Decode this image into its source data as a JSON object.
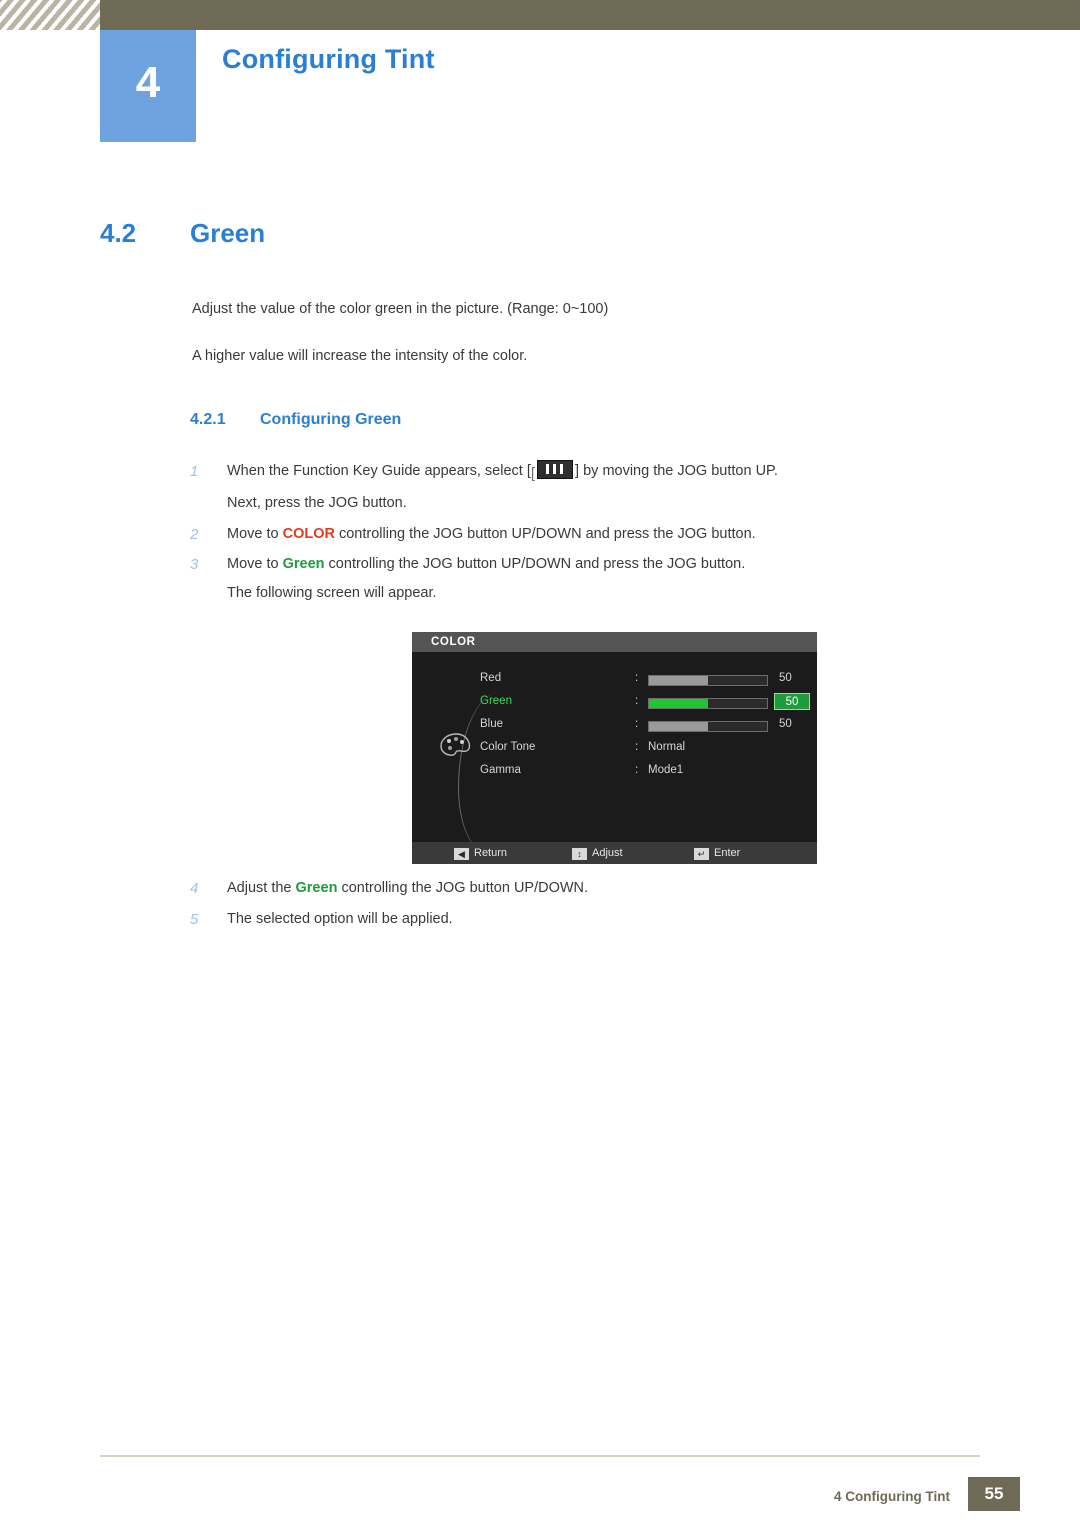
{
  "header": {
    "chapter_number": "4",
    "chapter_title": "Configuring Tint"
  },
  "section": {
    "number": "4.2",
    "title": "Green"
  },
  "intro": {
    "line1": "Adjust the value of the color green in the picture. (Range: 0~100)",
    "line2": "A higher value will increase the intensity of the color."
  },
  "subsection": {
    "number": "4.2.1",
    "title": "Configuring Green"
  },
  "steps": [
    {
      "num": "1",
      "text_before": "When the Function Key Guide appears, select [",
      "icon": "jog-guide-icon",
      "text_after": "] by moving the JOG button UP.",
      "line2": "Next, press the JOG button."
    },
    {
      "num": "2",
      "text_before": "Move to ",
      "keyword": "COLOR",
      "text_after": " controlling the JOG button UP/DOWN and press the JOG button."
    },
    {
      "num": "3",
      "text_before": "Move to ",
      "keyword": "Green",
      "text_after": " controlling the JOG button UP/DOWN and press the JOG button.",
      "line2": "The following screen will appear."
    },
    {
      "num": "4",
      "text_before": "Adjust the ",
      "keyword": "Green",
      "text_after": " controlling the JOG button UP/DOWN."
    },
    {
      "num": "5",
      "text_before": "The selected option will be applied."
    }
  ],
  "osd": {
    "title": "COLOR",
    "rows": [
      {
        "label": "Red",
        "colon": ":",
        "type": "bar",
        "value": "50",
        "fill_pct": 50,
        "highlight": false
      },
      {
        "label": "Green",
        "colon": ":",
        "type": "bar",
        "value": "50",
        "fill_pct": 50,
        "highlight": true
      },
      {
        "label": "Blue",
        "colon": ":",
        "type": "bar",
        "value": "50",
        "fill_pct": 50,
        "highlight": false
      },
      {
        "label": "Color Tone",
        "colon": ":",
        "type": "text",
        "value": "Normal",
        "highlight": false
      },
      {
        "label": "Gamma",
        "colon": ":",
        "type": "text",
        "value": "Mode1",
        "highlight": false
      }
    ],
    "footer": [
      {
        "icon": "◀",
        "label": "Return"
      },
      {
        "icon": "↕",
        "label": "Adjust"
      },
      {
        "icon": "↵",
        "label": "Enter"
      }
    ]
  },
  "footer": {
    "text": "4 Configuring Tint",
    "page": "55"
  },
  "colors": {
    "accent_blue": "#2a7fd4",
    "badge_blue": "#6fa3e0",
    "header_olive": "#6e6a56",
    "keyword_red": "#e03b1e",
    "keyword_green": "#1f9b3c",
    "osd_green": "#3ddc5a"
  }
}
